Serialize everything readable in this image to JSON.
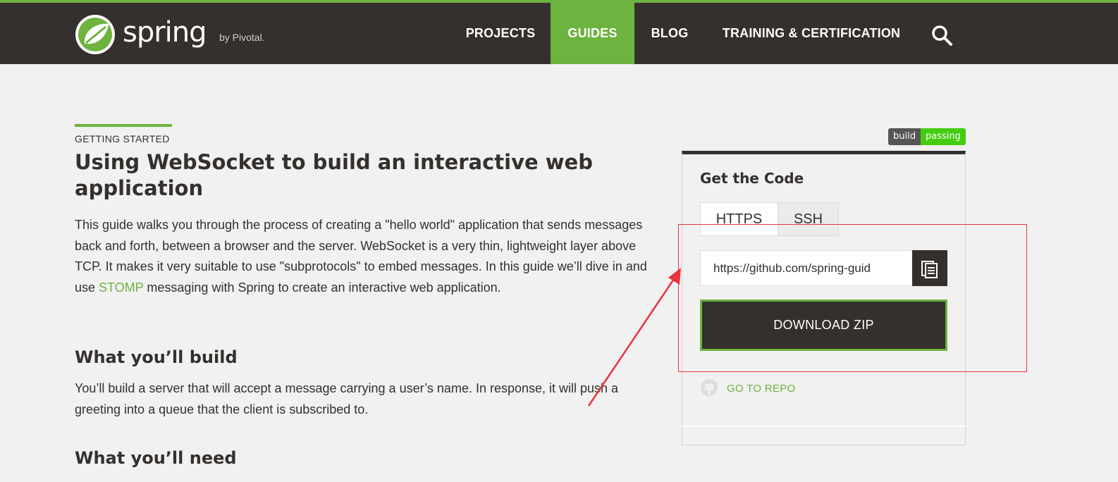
{
  "header": {
    "logo_word": "spring",
    "logo_by": "by Pivotal.",
    "nav": [
      {
        "label": "PROJECTS"
      },
      {
        "label": "GUIDES"
      },
      {
        "label": "BLOG"
      },
      {
        "label": "TRAINING & CERTIFICATION"
      }
    ],
    "active_nav": "GUIDES",
    "search_icon": "search-icon"
  },
  "article": {
    "eyebrow": "GETTING STARTED",
    "title": "Using WebSocket to build an interactive web application",
    "intro_before_link": "This guide walks you through the process of creating a \"hello world\" application that sends messages back and forth, between a browser and the server. WebSocket is a very thin, lightweight layer above TCP. It makes it very suitable to use \"subprotocols\" to embed messages. In this guide we’ll dive in and use ",
    "intro_link": "STOMP",
    "intro_after_link": " messaging with Spring to create an interactive web application.",
    "section1_heading": "What you’ll build",
    "section1_text": "You’ll build a server that will accept a message carrying a user’s name. In response, it will push a greeting into a queue that the client is subscribed to.",
    "section2_heading": "What you’ll need"
  },
  "sidebar": {
    "badge_left": "build",
    "badge_right": "passing",
    "card_title": "Get the Code",
    "tabs": [
      {
        "label": "HTTPS"
      },
      {
        "label": "SSH"
      }
    ],
    "active_tab": "HTTPS",
    "clone_url": "https://github.com/spring-guid",
    "copy_icon": "clipboard-icon",
    "download_label": "DOWNLOAD ZIP",
    "repo_icon": "github-icon",
    "repo_label": "GO TO REPO"
  },
  "watermark": "https://blog.csdn.net/qq_35262405",
  "colors": {
    "brand_green": "#6db33f",
    "header_dark": "#34302d",
    "background": "#f1f1f1",
    "annotation_red": "#e8333a",
    "badge_passing": "#44cc11"
  }
}
